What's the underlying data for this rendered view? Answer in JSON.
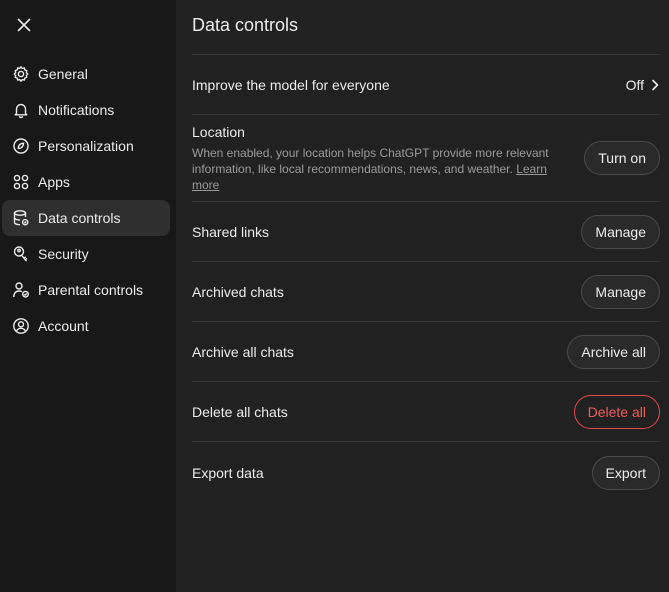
{
  "sidebar": {
    "items": [
      {
        "label": "General",
        "icon": "gear-icon"
      },
      {
        "label": "Notifications",
        "icon": "bell-icon"
      },
      {
        "label": "Personalization",
        "icon": "personalization-icon"
      },
      {
        "label": "Apps",
        "icon": "apps-grid-icon"
      },
      {
        "label": "Data controls",
        "icon": "database-icon",
        "active": true
      },
      {
        "label": "Security",
        "icon": "key-icon"
      },
      {
        "label": "Parental controls",
        "icon": "parental-icon"
      },
      {
        "label": "Account",
        "icon": "account-icon"
      }
    ]
  },
  "main": {
    "title": "Data controls",
    "improve": {
      "label": "Improve the model for everyone",
      "value": "Off"
    },
    "location": {
      "label": "Location",
      "description": "When enabled, your location helps ChatGPT provide more relevant information, like local recommendations, news, and weather.",
      "link": "Learn more",
      "button": "Turn on"
    },
    "shared_links": {
      "label": "Shared links",
      "button": "Manage"
    },
    "archived_chats": {
      "label": "Archived chats",
      "button": "Manage"
    },
    "archive_all": {
      "label": "Archive all chats",
      "button": "Archive all"
    },
    "delete_all": {
      "label": "Delete all chats",
      "button": "Delete all"
    },
    "export": {
      "label": "Export data",
      "button": "Export"
    }
  },
  "colors": {
    "background": "#212121",
    "sidebar": "#181818",
    "danger": "#ef5b5b"
  }
}
